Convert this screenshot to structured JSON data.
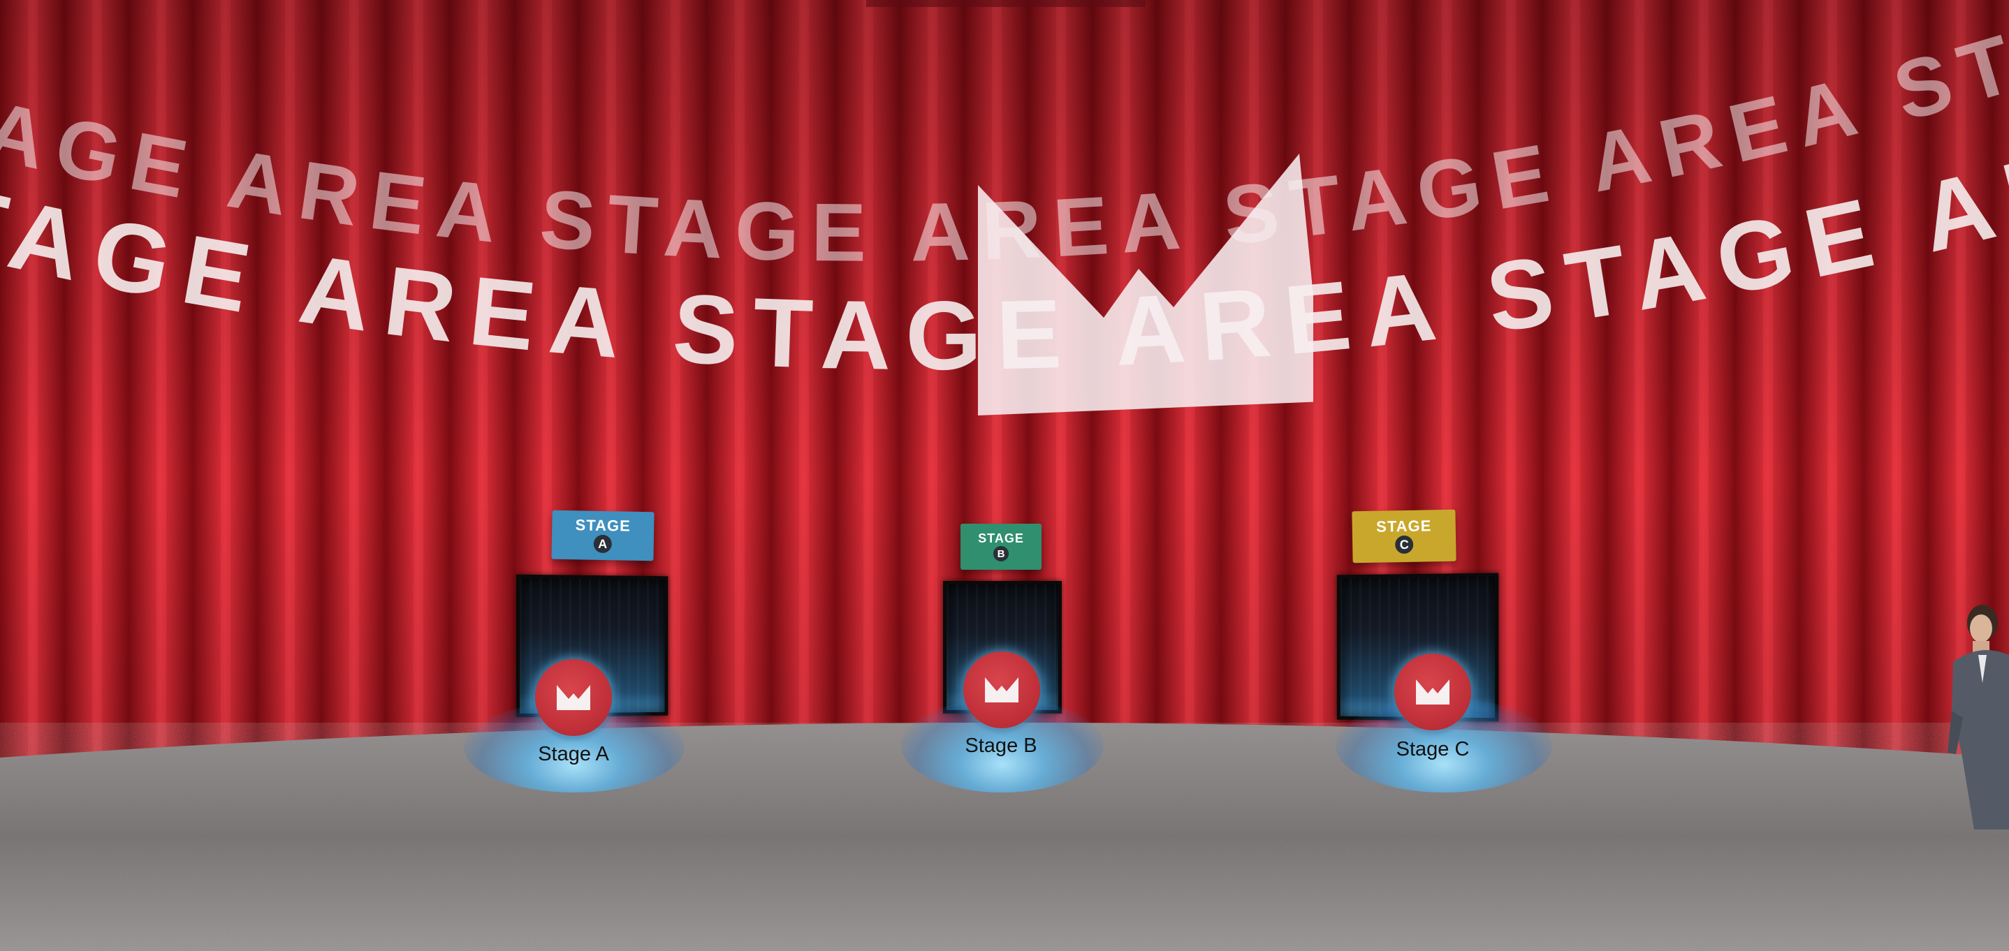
{
  "scene": {
    "banner_text": "STAGE AREA",
    "curtain_color": "#c9202b",
    "floor_color": "#8c8888"
  },
  "signs": [
    {
      "word": "STAGE",
      "letter": "A",
      "color": "#3f8fbf"
    },
    {
      "word": "STAGE",
      "letter": "B",
      "color": "#2f8f6e"
    },
    {
      "word": "STAGE",
      "letter": "C",
      "color": "#c9a72c"
    }
  ],
  "portals": [
    {
      "label": "Stage A",
      "icon": "crown-icon"
    },
    {
      "label": "Stage B",
      "icon": "crown-icon"
    },
    {
      "label": "Stage C",
      "icon": "crown-icon"
    }
  ],
  "avatar": {
    "icon": "avatar-figure"
  }
}
